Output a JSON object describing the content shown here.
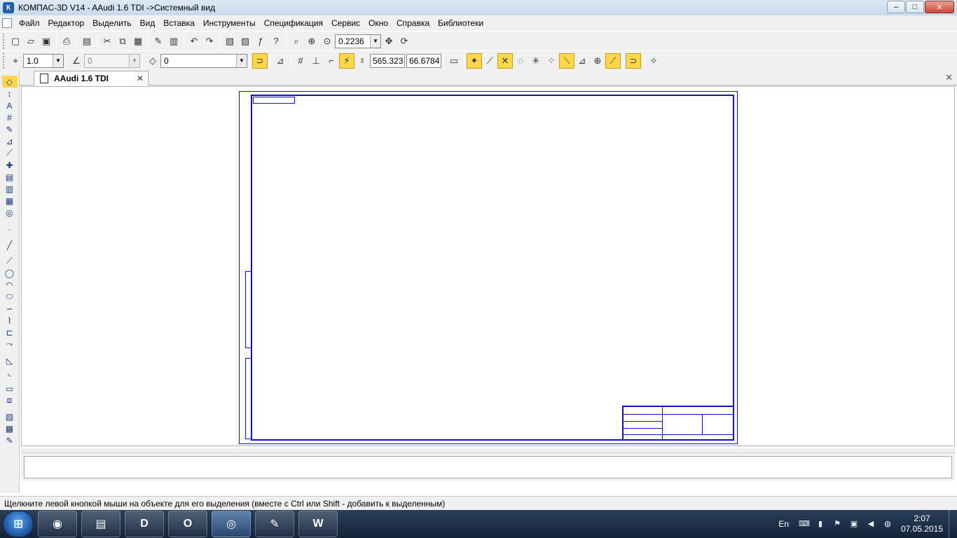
{
  "window": {
    "title": "КОМПАС-3D V14 - AAudi 1.6 TDI ->Системный вид",
    "logo": "К",
    "minimize": "–",
    "maximize": "□",
    "close": "✕"
  },
  "menu": [
    "Файл",
    "Редактор",
    "Выделить",
    "Вид",
    "Вставка",
    "Инструменты",
    "Спецификация",
    "Сервис",
    "Окно",
    "Справка",
    "Библиотеки"
  ],
  "toolbar1": {
    "zoom_value": "0.2236"
  },
  "toolbar2": {
    "step_value": "1.0",
    "angle_value": "0",
    "layer_value": "0",
    "coord_x": "565.323",
    "coord_y": "66.6784"
  },
  "tab": {
    "label": "AAudi 1.6 TDI",
    "close": "✕"
  },
  "status": {
    "hint": "Щелкните левой кнопкой мыши на объекте для его выделения (вместе с Ctrl или Shift - добавить к выделенным)"
  },
  "taskbar": {
    "start_glyph": "⊞",
    "apps": [
      {
        "name": "chrome",
        "glyph": "◉"
      },
      {
        "name": "explorer",
        "glyph": "▤"
      },
      {
        "name": "daemon-tools",
        "glyph": "D"
      },
      {
        "name": "opera",
        "glyph": "O"
      },
      {
        "name": "kompas",
        "glyph": "◎"
      },
      {
        "name": "onenote",
        "glyph": "✎"
      },
      {
        "name": "word",
        "glyph": "W"
      }
    ],
    "language": "En",
    "time": "2:07",
    "date": "07.05.2015"
  },
  "colors": {
    "sheet_line": "#1010c8",
    "active_toggle": "#ffd84a",
    "taskbar": "#1c2e46"
  },
  "icons": {
    "titlebar": [
      "kompas-logo-icon"
    ],
    "toolbar1": [
      "new-document-icon",
      "open-icon",
      "save-icon",
      "print-icon",
      "preview-icon",
      "cut-icon",
      "copy-icon",
      "paste-icon",
      "properties-icon",
      "manager-icon",
      "undo-icon",
      "redo-icon",
      "model-tree-icon",
      "variables-icon",
      "fx-icon",
      "help-icon",
      "zoom-window-icon",
      "zoom-scale-icon",
      "zoom-fit-icon",
      "pan-icon",
      "refresh-icon"
    ],
    "toolbar2": [
      "snap-step-icon",
      "layer-icon",
      "magnet-icon",
      "ortho-icon",
      "grid-icon",
      "local-cs-icon",
      "round-icon",
      "snap-settings-icon",
      "hide-icon",
      "point-snap-icon",
      "nearest-icon",
      "intersection-icon",
      "center-icon",
      "tangent-icon",
      "midpoint-icon",
      "angle-icon",
      "axis-icon",
      "collision-icon",
      "magnet-2-icon",
      "extra-icon"
    ]
  }
}
